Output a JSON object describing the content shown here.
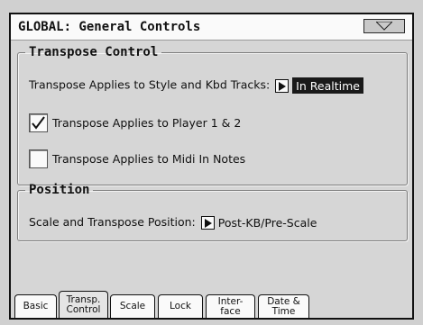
{
  "window": {
    "title": "GLOBAL: General Controls"
  },
  "transpose_group": {
    "legend": "Transpose Control",
    "applies_label": "Transpose Applies to Style and Kbd Tracks:",
    "applies_value": "In Realtime",
    "player_label": "Transpose Applies to Player 1 & 2",
    "player_checked": true,
    "midi_label": "Transpose Applies to Midi In Notes",
    "midi_checked": false
  },
  "position_group": {
    "legend": "Position",
    "scale_label": "Scale and Transpose Position:",
    "scale_value": "Post-KB/Pre-Scale"
  },
  "tabs": [
    {
      "line1": "Basic",
      "line2": ""
    },
    {
      "line1": "Transp.",
      "line2": "Control"
    },
    {
      "line1": "Scale",
      "line2": ""
    },
    {
      "line1": "Lock",
      "line2": ""
    },
    {
      "line1": "Inter-",
      "line2": "face"
    },
    {
      "line1": "Date &",
      "line2": "Time"
    }
  ],
  "active_tab": "Transp. Control",
  "icons": {
    "menu": "triangle-down-icon",
    "arrow": "triangle-right-icon",
    "check": "checkmark-icon"
  }
}
